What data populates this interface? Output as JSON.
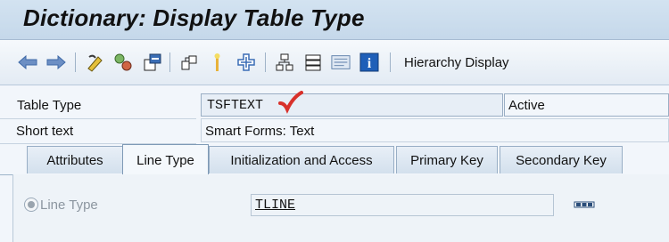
{
  "window": {
    "title": "Dictionary: Display Table Type"
  },
  "toolbar": {
    "icons": [
      "back-arrow-icon",
      "forward-arrow-icon",
      "edit-icon",
      "other-object-icon",
      "activate-icon",
      "where-used-icon",
      "object-list-icon",
      "navigate-icon",
      "hierarchy-icon",
      "tree-icon",
      "documentation-icon",
      "info-icon"
    ],
    "hierarchy_label": "Hierarchy Display"
  },
  "form": {
    "table_type_label": "Table Type",
    "table_type_value": "TSFTEXT",
    "status": "Active",
    "short_text_label": "Short text",
    "short_text_value": "Smart Forms: Text"
  },
  "tabs": [
    {
      "label": "Attributes"
    },
    {
      "label": "Line Type"
    },
    {
      "label": "Initialization and Access"
    },
    {
      "label": "Primary Key"
    },
    {
      "label": "Secondary Key"
    }
  ],
  "active_tab": "Line Type",
  "line_type": {
    "radio_label": "Line Type",
    "value": "TLINE",
    "more_button": "more-icon"
  },
  "colors": {
    "title_bg": "#c9dbec",
    "check": "#d8312b",
    "accent": "#3a6db5"
  }
}
